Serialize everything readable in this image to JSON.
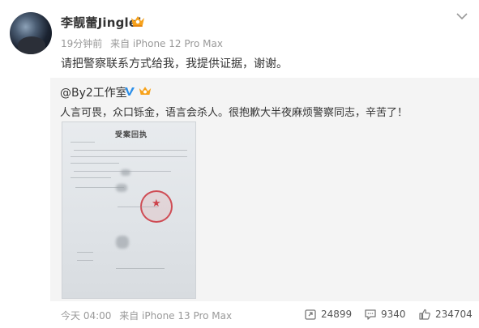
{
  "post": {
    "author": "李靓蕾Jinglei",
    "time": "19分钟前",
    "source": "来自 iPhone 12 Pro Max",
    "text": "请把警察联系方式给我，我提供证据，谢谢。"
  },
  "repost": {
    "author": "@By2工作室",
    "text": "人言可畏，众口铄金，语言会杀人。很抱歉大半夜麻烦警察同志，辛苦了！",
    "document_title": "受案回执"
  },
  "footer": {
    "time": "今天 04:00",
    "source": "来自 iPhone 13 Pro Max",
    "reposts": "24899",
    "comments": "9340",
    "likes": "234704"
  },
  "colors": {
    "text": "#333333",
    "meta": "#999999",
    "repost_bg": "#f4f4f4",
    "vip_orange": "#f7a21b",
    "verified_blue": "#2c8fe9"
  },
  "icons": {
    "menu": "chevron-down-icon",
    "vip": "vip-crown-icon",
    "verified": "verified-v-icon",
    "repost": "repost-icon",
    "comment": "comment-icon",
    "like": "thumbs-up-icon"
  }
}
